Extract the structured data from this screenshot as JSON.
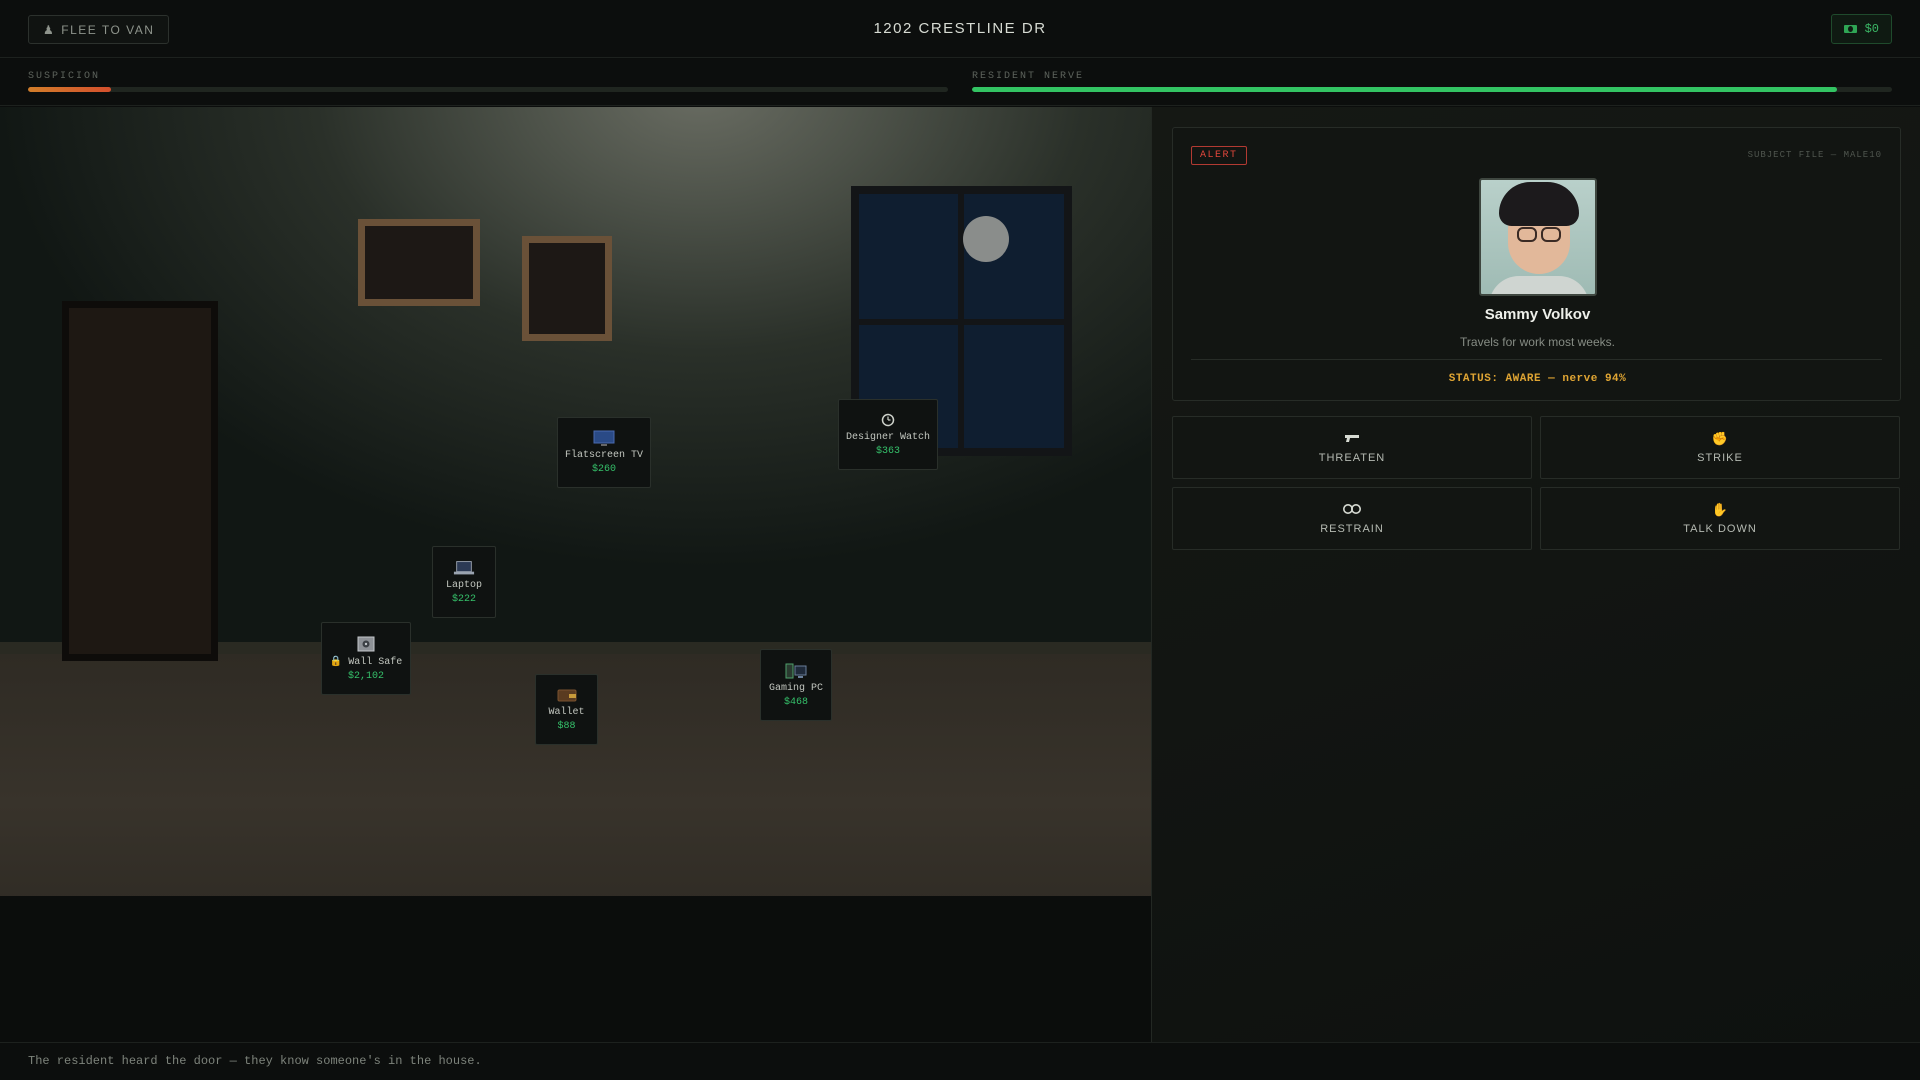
{
  "header": {
    "flee_label": "FLEE TO VAN",
    "address": "1202 CRESTLINE DR",
    "cash": "$0"
  },
  "meters": {
    "suspicion": {
      "label": "SUSPICION",
      "percent": 9,
      "color": "#d4502d"
    },
    "nerve": {
      "label": "RESIDENT NERVE",
      "percent": 94,
      "color": "#33c463"
    }
  },
  "loot": [
    {
      "id": "flatscreen-tv",
      "name": "Flatscreen TV",
      "value": "$260",
      "icon": "tv-icon",
      "locked": false
    },
    {
      "id": "designer-watch",
      "name": "Designer Watch",
      "value": "$363",
      "icon": "watch-icon",
      "locked": false
    },
    {
      "id": "laptop",
      "name": "Laptop",
      "value": "$222",
      "icon": "laptop-icon",
      "locked": false
    },
    {
      "id": "wall-safe",
      "name": "Wall Safe",
      "value": "$2,102",
      "icon": "safe-icon",
      "locked": true
    },
    {
      "id": "wallet",
      "name": "Wallet",
      "value": "$88",
      "icon": "wallet-icon",
      "locked": false
    },
    {
      "id": "gaming-pc",
      "name": "Gaming PC",
      "value": "$468",
      "icon": "computer-icon",
      "locked": false
    }
  ],
  "subject": {
    "badge": "ALERT",
    "file": "SUBJECT FILE — MALE10",
    "name": "Sammy Volkov",
    "bio": "Travels for work most weeks.",
    "status": "STATUS: AWARE — nerve 94%"
  },
  "actions": [
    {
      "label": "THREATEN",
      "icon": "gun-icon"
    },
    {
      "label": "STRIKE",
      "icon": "fist-icon"
    },
    {
      "label": "RESTRAIN",
      "icon": "handcuffs-icon"
    },
    {
      "label": "TALK DOWN",
      "icon": "hand-icon"
    }
  ],
  "log": "The resident heard the door — they know someone's in the house."
}
